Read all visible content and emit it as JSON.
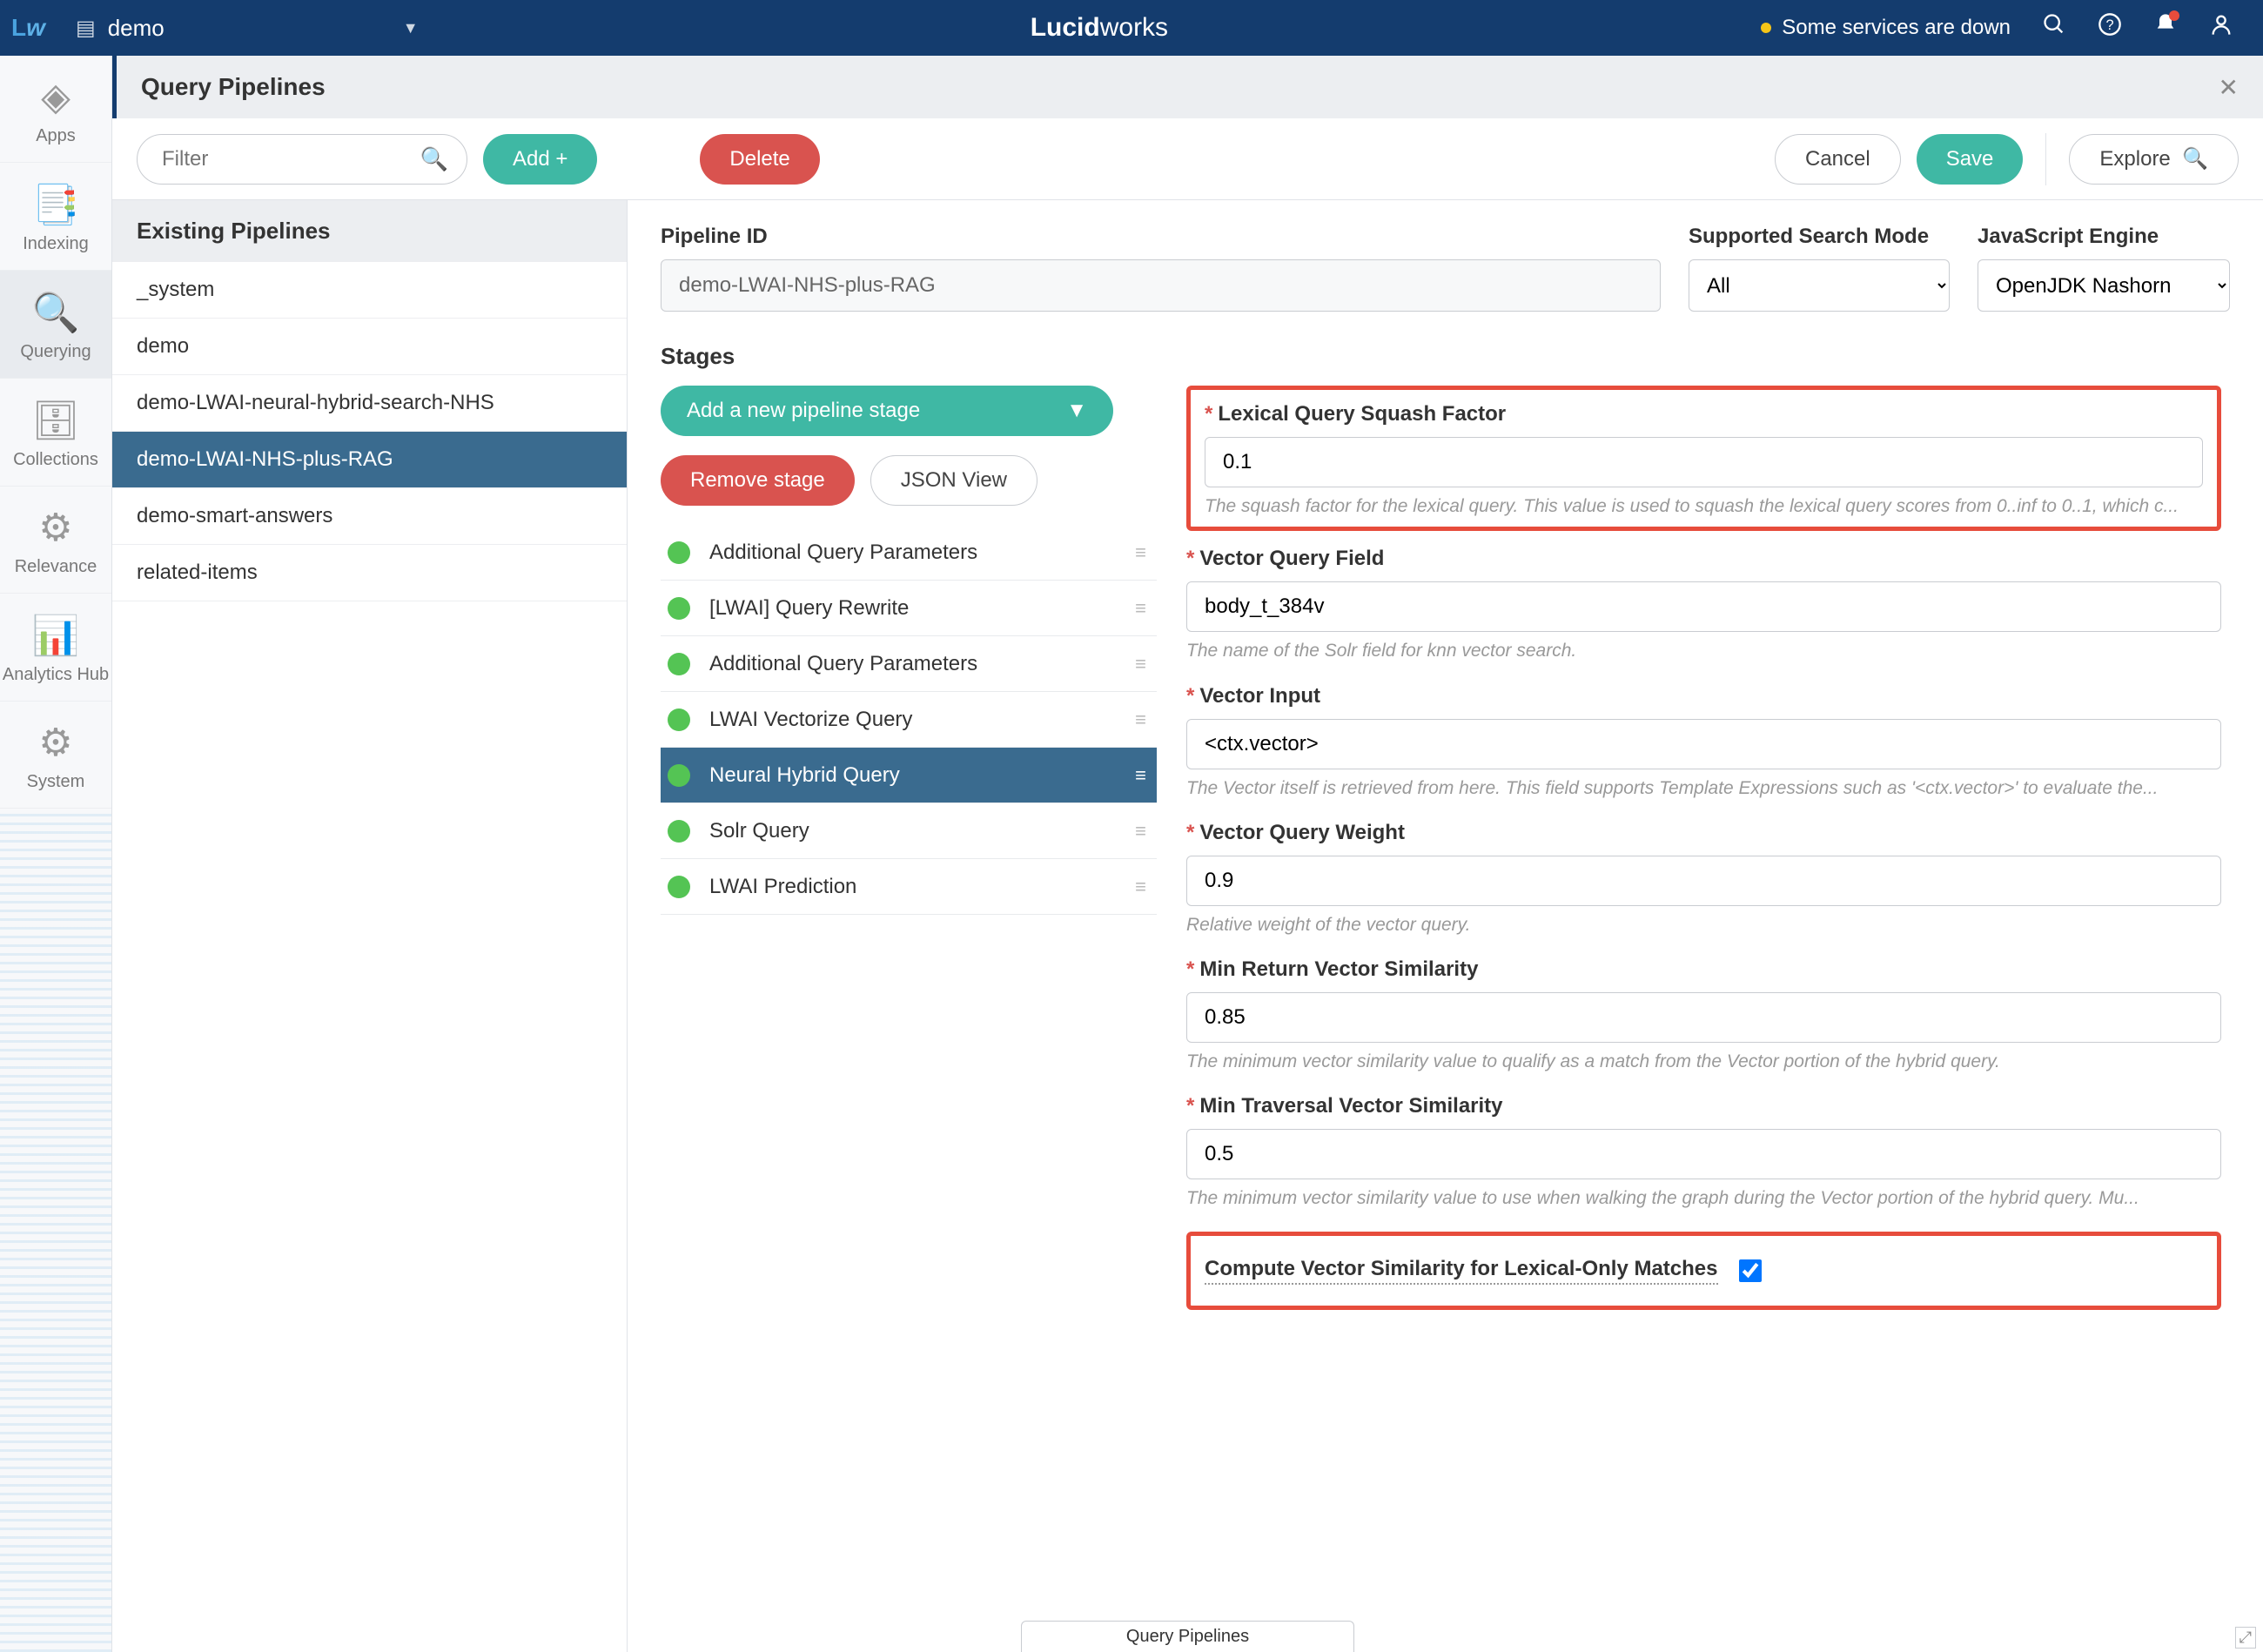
{
  "header": {
    "logo": "Lw",
    "app_name": "demo",
    "brand_bold": "Lucid",
    "brand_light": "works",
    "status_text": "Some services are down"
  },
  "leftnav": [
    {
      "label": "Apps"
    },
    {
      "label": "Indexing"
    },
    {
      "label": "Querying"
    },
    {
      "label": "Collections"
    },
    {
      "label": "Relevance"
    },
    {
      "label": "Analytics Hub"
    },
    {
      "label": "System"
    }
  ],
  "page_title": "Query Pipelines",
  "toolbar": {
    "filter_placeholder": "Filter",
    "add": "Add +",
    "delete": "Delete",
    "cancel": "Cancel",
    "save": "Save",
    "explore": "Explore"
  },
  "pipelines_header": "Existing Pipelines",
  "pipelines": [
    {
      "name": "_system"
    },
    {
      "name": "demo"
    },
    {
      "name": "demo-LWAI-neural-hybrid-search-NHS"
    },
    {
      "name": "demo-LWAI-NHS-plus-RAG",
      "selected": true
    },
    {
      "name": "demo-smart-answers"
    },
    {
      "name": "related-items"
    }
  ],
  "editor": {
    "pipeline_id_label": "Pipeline ID",
    "pipeline_id": "demo-LWAI-NHS-plus-RAG",
    "ssm_label": "Supported Search Mode",
    "ssm_value": "All",
    "jse_label": "JavaScript Engine",
    "jse_value": "OpenJDK Nashorn",
    "stages_label": "Stages",
    "add_stage": "Add a new pipeline stage",
    "remove_stage": "Remove stage",
    "json_view": "JSON View"
  },
  "stages": [
    {
      "name": "Additional Query Parameters"
    },
    {
      "name": "[LWAI] Query Rewrite"
    },
    {
      "name": "Additional Query Parameters"
    },
    {
      "name": "LWAI Vectorize Query"
    },
    {
      "name": "Neural Hybrid Query",
      "selected": true
    },
    {
      "name": "Solr Query"
    },
    {
      "name": "LWAI Prediction"
    }
  ],
  "form": {
    "f1_label": "Lexical Query Squash Factor",
    "f1_value": "0.1",
    "f1_help": "The squash factor for the lexical query.  This value is used to squash the lexical query scores from 0..inf to 0..1, which c...",
    "f2_label": "Vector Query Field",
    "f2_value": "body_t_384v",
    "f2_help": "The name of the Solr field for knn vector search.",
    "f3_label": "Vector Input",
    "f3_value": "<ctx.vector>",
    "f3_help": "The Vector itself is retrieved from here.  This field supports Template Expressions such as '<ctx.vector>' to evaluate the...",
    "f4_label": "Vector Query Weight",
    "f4_value": "0.9",
    "f4_help": "Relative weight of the vector query.",
    "f5_label": "Min Return Vector Similarity",
    "f5_value": "0.85",
    "f5_help": "The minimum vector similarity value to qualify as a match from the Vector portion of the hybrid query.",
    "f6_label": "Min Traversal Vector Similarity",
    "f6_value": "0.5",
    "f6_help": "The minimum vector similarity value to use when walking the graph during the Vector portion of the hybrid query. Mu...",
    "f7_label": "Compute Vector Similarity for Lexical-Only Matches"
  },
  "footer_tab": "Query Pipelines"
}
